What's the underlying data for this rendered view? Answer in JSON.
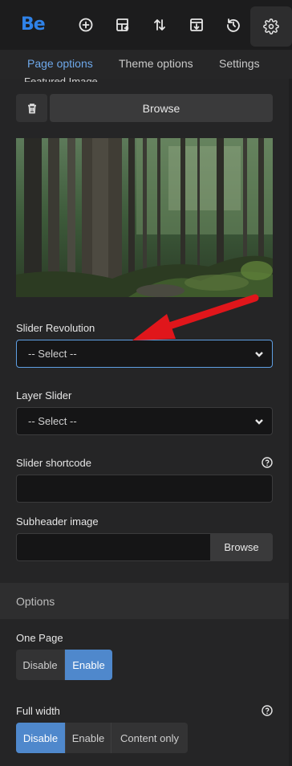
{
  "toolbar": {
    "logo": "Be",
    "icons": [
      "add-icon",
      "layout-add-icon",
      "sort-icon",
      "download-icon",
      "history-icon",
      "gear-icon"
    ]
  },
  "tabs": [
    {
      "label": "Page options",
      "active": true
    },
    {
      "label": "Theme options",
      "active": false
    },
    {
      "label": "Settings",
      "active": false
    }
  ],
  "featured": {
    "label": "Featured Image",
    "browse_label": "Browse"
  },
  "slider_revolution": {
    "label": "Slider Revolution",
    "value": "-- Select --"
  },
  "layer_slider": {
    "label": "Layer Slider",
    "value": "-- Select --"
  },
  "slider_shortcode": {
    "label": "Slider shortcode",
    "value": ""
  },
  "subheader_image": {
    "label": "Subheader image",
    "value": "",
    "browse_label": "Browse"
  },
  "options_section": {
    "title": "Options"
  },
  "one_page": {
    "label": "One Page",
    "options": [
      "Disable",
      "Enable"
    ],
    "selected": "Enable"
  },
  "full_width": {
    "label": "Full width",
    "options": [
      "Disable",
      "Enable",
      "Content only"
    ],
    "selected": "Disable"
  },
  "colors": {
    "accent": "#4f88cc",
    "tab_active": "#6ea8ea",
    "logo": "#2f82e8",
    "annotation_arrow": "#e0161b"
  }
}
